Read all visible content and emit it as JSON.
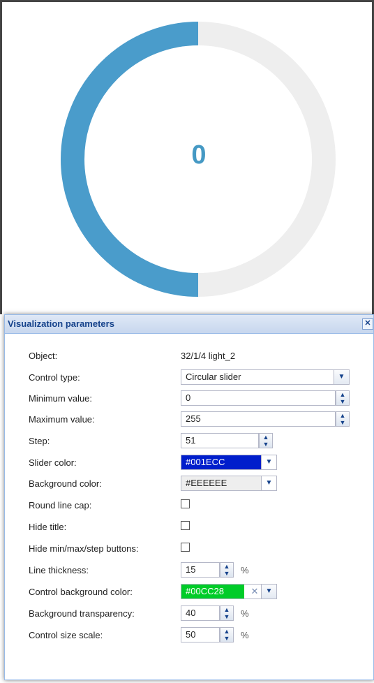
{
  "preview": {
    "value": "0",
    "slider_fraction": 0.5,
    "colors": {
      "slider": "#4a9ccb",
      "background": "#eeeeee",
      "value_text": "#4599c4"
    }
  },
  "panel": {
    "title": "Visualization parameters",
    "close_icon": "close-icon",
    "fields": {
      "object": {
        "label": "Object:",
        "value": "32/1/4 light_2"
      },
      "control_type": {
        "label": "Control type:",
        "value": "Circular slider"
      },
      "min_value": {
        "label": "Minimum value:",
        "value": "0"
      },
      "max_value": {
        "label": "Maximum value:",
        "value": "255"
      },
      "step": {
        "label": "Step:",
        "value": "51"
      },
      "slider_color": {
        "label": "Slider color:",
        "value": "#001ECC",
        "swatch": "#001ECC"
      },
      "background_color": {
        "label": "Background color:",
        "value": "#EEEEEE",
        "swatch": "#EEEEEE"
      },
      "round_line_cap": {
        "label": "Round line cap:",
        "checked": false
      },
      "hide_title": {
        "label": "Hide title:",
        "checked": false
      },
      "hide_buttons": {
        "label": "Hide min/max/step buttons:",
        "checked": false
      },
      "line_thickness": {
        "label": "Line thickness:",
        "value": "15",
        "unit": "%"
      },
      "control_bg_color": {
        "label": "Control background color:",
        "value": "#00CC28",
        "swatch": "#00CC28"
      },
      "bg_transparency": {
        "label": "Background transparency:",
        "value": "40",
        "unit": "%"
      },
      "size_scale": {
        "label": "Control size scale:",
        "value": "50",
        "unit": "%"
      }
    }
  }
}
